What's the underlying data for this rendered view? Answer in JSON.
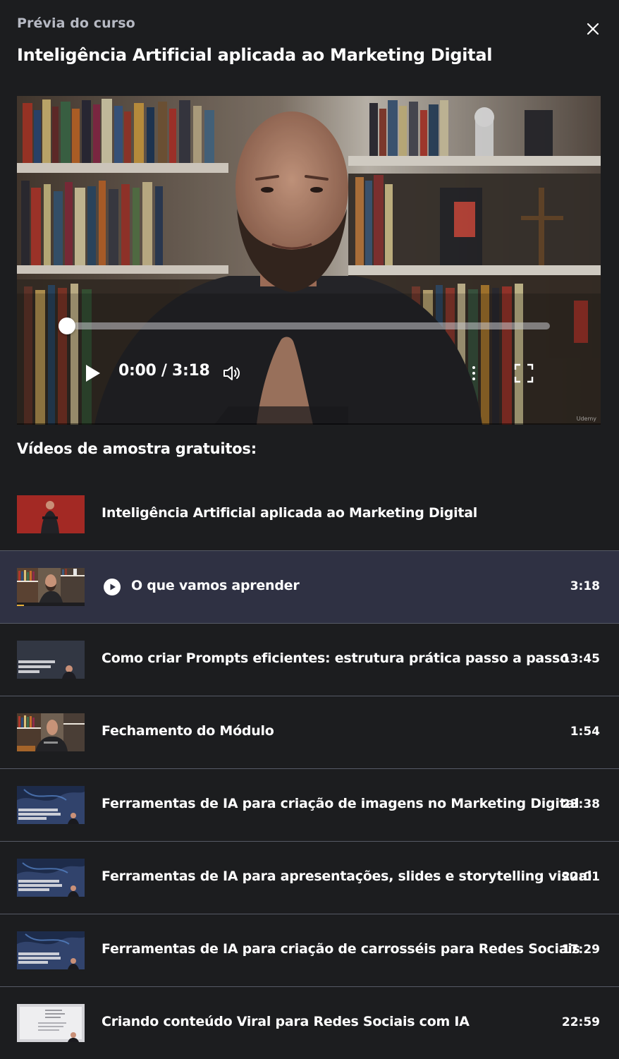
{
  "header": {
    "eyebrow": "Prévia do curso",
    "title": "Inteligência Artificial aplicada ao Marketing Digital",
    "close_icon": "close-icon"
  },
  "player": {
    "time": "0:00 / 3:18",
    "progress": 0,
    "watermark": "Udemy",
    "icons": [
      "play-icon",
      "volume-icon",
      "more-vertical-icon",
      "fullscreen-icon"
    ]
  },
  "samples": {
    "title": "Vídeos de amostra gratuitos:",
    "items": [
      {
        "title": "Inteligência Artificial aplicada ao Marketing Digital",
        "duration": "",
        "thumb": "red",
        "active": false
      },
      {
        "title": "O que vamos aprender",
        "duration": "3:18",
        "thumb": "bookshelf",
        "active": true
      },
      {
        "title": "Como criar Prompts eficientes: estrutura prática passo a passo",
        "duration": "13:45",
        "thumb": "dark",
        "active": false
      },
      {
        "title": "Fechamento do Módulo",
        "duration": "1:54",
        "thumb": "bookshelf",
        "active": false
      },
      {
        "title": "Ferramentas de IA para criação de imagens no Marketing Digital",
        "duration": "23:38",
        "thumb": "blue",
        "active": false
      },
      {
        "title": "Ferramentas de IA para apresentações, slides e storytelling visual",
        "duration": "22:01",
        "thumb": "blue",
        "active": false
      },
      {
        "title": "Ferramentas de IA para criação de carrosséis para Redes Sociais",
        "duration": "17:29",
        "thumb": "blue",
        "active": false
      },
      {
        "title": "Criando conteúdo Viral para Redes Sociais com IA",
        "duration": "22:59",
        "thumb": "doc",
        "active": false
      }
    ]
  },
  "colors": {
    "background": "#1c1d1f",
    "active_row": "#2f3143",
    "divider": "#565a66",
    "eyebrow": "#b6b9c3"
  }
}
